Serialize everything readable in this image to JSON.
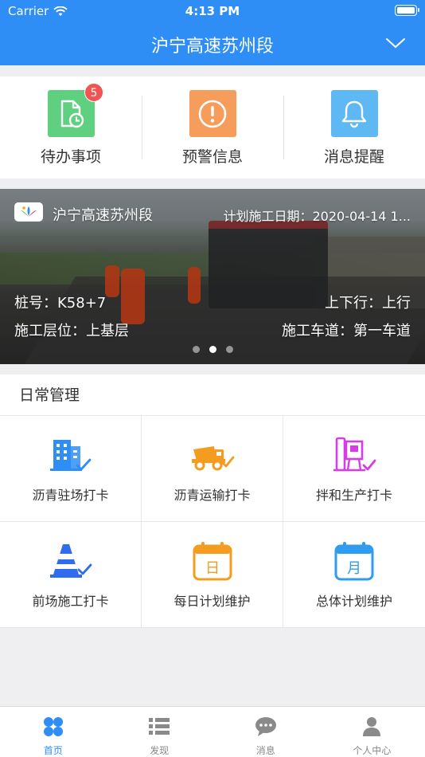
{
  "status_bar": {
    "carrier": "Carrier",
    "time": "4:13 PM"
  },
  "header": {
    "title": "沪宁高速苏州段"
  },
  "quick_actions": [
    {
      "label": "待办事项",
      "badge": "5",
      "color": "#5fcf80",
      "icon": "todo-clock-icon"
    },
    {
      "label": "预警信息",
      "color": "#f79d5c",
      "icon": "warning-icon"
    },
    {
      "label": "消息提醒",
      "color": "#5db8f3",
      "icon": "bell-icon"
    }
  ],
  "banner": {
    "section_name": "沪宁高速苏州段",
    "plan_date": "计划施工日期：2020-04-14 1...",
    "stake": "桩号：K58+7",
    "direction": "上下行：上行",
    "layer": "施工层位：上基层",
    "lane": "施工车道：第一车道",
    "pager_active": 2,
    "pager_total": 3
  },
  "daily": {
    "title": "日常管理",
    "items": [
      {
        "label": "沥青驻场打卡",
        "icon": "building-check-icon"
      },
      {
        "label": "沥青运输打卡",
        "icon": "truck-check-icon"
      },
      {
        "label": "拌和生产打卡",
        "icon": "mixing-plant-icon"
      },
      {
        "label": "前场施工打卡",
        "icon": "traffic-cone-check-icon"
      },
      {
        "label": "每日计划维护",
        "icon": "calendar-day-icon"
      },
      {
        "label": "总体计划维护",
        "icon": "calendar-month-icon"
      }
    ],
    "colors": {
      "blue": "#2f8ef6",
      "orange": "#f39c1f",
      "purple": "#d63de6"
    }
  },
  "tabbar": {
    "tabs": [
      {
        "label": "首页",
        "icon": "home-grid-icon",
        "active": true
      },
      {
        "label": "发现",
        "icon": "list-icon",
        "active": false
      },
      {
        "label": "消息",
        "icon": "chat-bubble-icon",
        "active": false
      },
      {
        "label": "个人中心",
        "icon": "person-icon",
        "active": false
      }
    ],
    "active_color": "#2f8ef6",
    "inactive_color": "#8a8a8a"
  }
}
